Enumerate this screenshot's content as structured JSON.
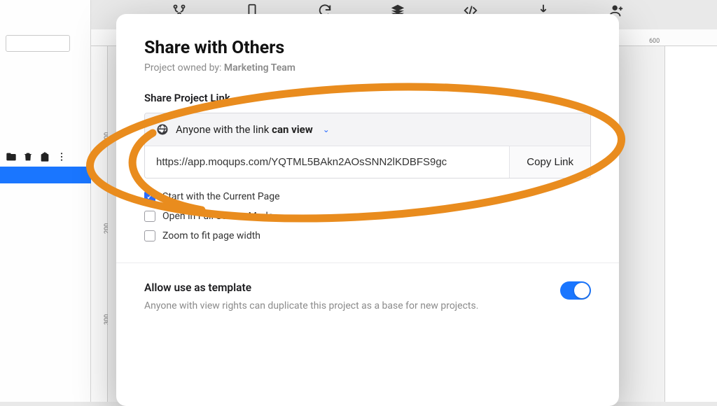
{
  "ruler": {
    "top": "600",
    "left": [
      "100",
      "200",
      "300"
    ]
  },
  "modal": {
    "title": "Share with Others",
    "owner_prefix": "Project owned by: ",
    "owner_name": "Marketing Team",
    "share_section_label": "Share Project Link",
    "access": {
      "prefix": "Anyone with the link ",
      "perm": "can view"
    },
    "url_value": "https://app.moqups.com/YQTML5BAkn2AOsSNN2lKDBFS9gc",
    "copy_label": "Copy Link",
    "checks": {
      "start_current": {
        "label": "Start with the Current Page",
        "checked": true
      },
      "fullscreen": {
        "label": "Open in Full Screen Mode",
        "checked": false
      },
      "zoom_fit": {
        "label": "Zoom to fit page width",
        "checked": false
      }
    },
    "template": {
      "title": "Allow use as template",
      "desc": "Anyone with view rights can duplicate this project as a base for new projects."
    }
  },
  "colors": {
    "accent": "#1a76ff",
    "annotation": "#e98c1e"
  }
}
